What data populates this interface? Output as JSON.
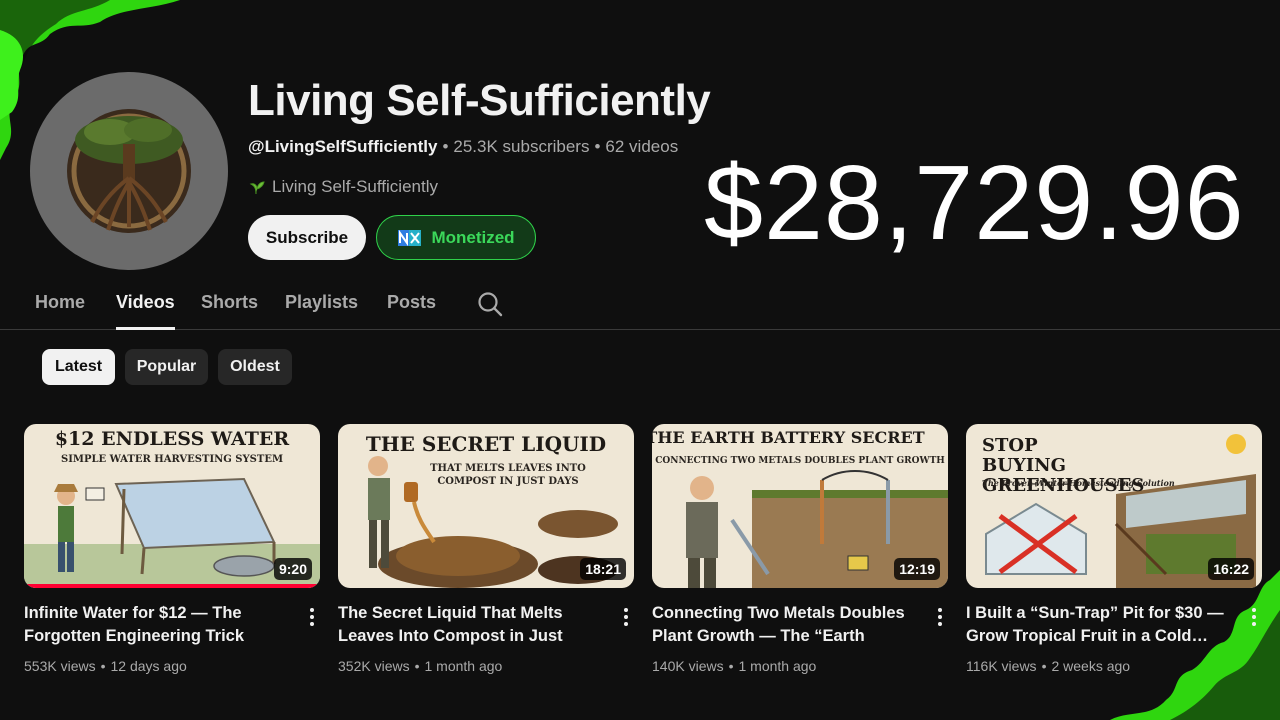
{
  "channel": {
    "name": "Living Self-Sufficiently",
    "handle": "@LivingSelfSufficiently",
    "subscribers": "25.3K subscribers",
    "video_count": "62 videos",
    "description": "Living Self-Sufficiently",
    "subscribe_label": "Subscribe",
    "monetized_label": "Monetized",
    "earnings": "$28,729.96"
  },
  "tabs": [
    "Home",
    "Videos",
    "Shorts",
    "Playlists",
    "Posts"
  ],
  "active_tab": "Videos",
  "chips": [
    "Latest",
    "Popular",
    "Oldest"
  ],
  "selected_chip": "Latest",
  "videos": [
    {
      "title": "Infinite Water for $12 — The Forgotten Engineering Trick",
      "views": "553K views",
      "age": "12 days ago",
      "duration": "9:20",
      "watched_fraction": 1.0,
      "thumb_title": "$12 ENDLESS WATER",
      "thumb_sub": "SIMPLE WATER HARVESTING SYSTEM"
    },
    {
      "title": "The Secret Liquid That Melts Leaves Into Compost in Just Days!",
      "views": "352K views",
      "age": "1 month ago",
      "duration": "18:21",
      "thumb_title": "THE SECRET LIQUID",
      "thumb_sub": "THAT MELTS LEAVES INTO COMPOST IN JUST DAYS"
    },
    {
      "title": "Connecting Two Metals Doubles Plant Growth — The “Earth Battery…",
      "views": "140K views",
      "age": "1 month ago",
      "duration": "12:19",
      "thumb_title": "THE EARTH BATTERY SECRET",
      "thumb_sub": "CONNECTING TWO METALS DOUBLES PLANT GROWTH"
    },
    {
      "title": "I Built a “Sun-Trap” Pit for $30 — Grow Tropical Fruit in a Cold…",
      "views": "116K views",
      "age": "2 weeks ago",
      "duration": "16:22",
      "thumb_title": "STOP BUYING GREENHOUSES",
      "thumb_sub": "The Proven Winter Homesteading Solution"
    }
  ],
  "colors": {
    "background": "#0f0f0f",
    "monetized_green": "#3bd85a",
    "progress_red": "#ff0033",
    "flame_green": "#2fd60f"
  }
}
